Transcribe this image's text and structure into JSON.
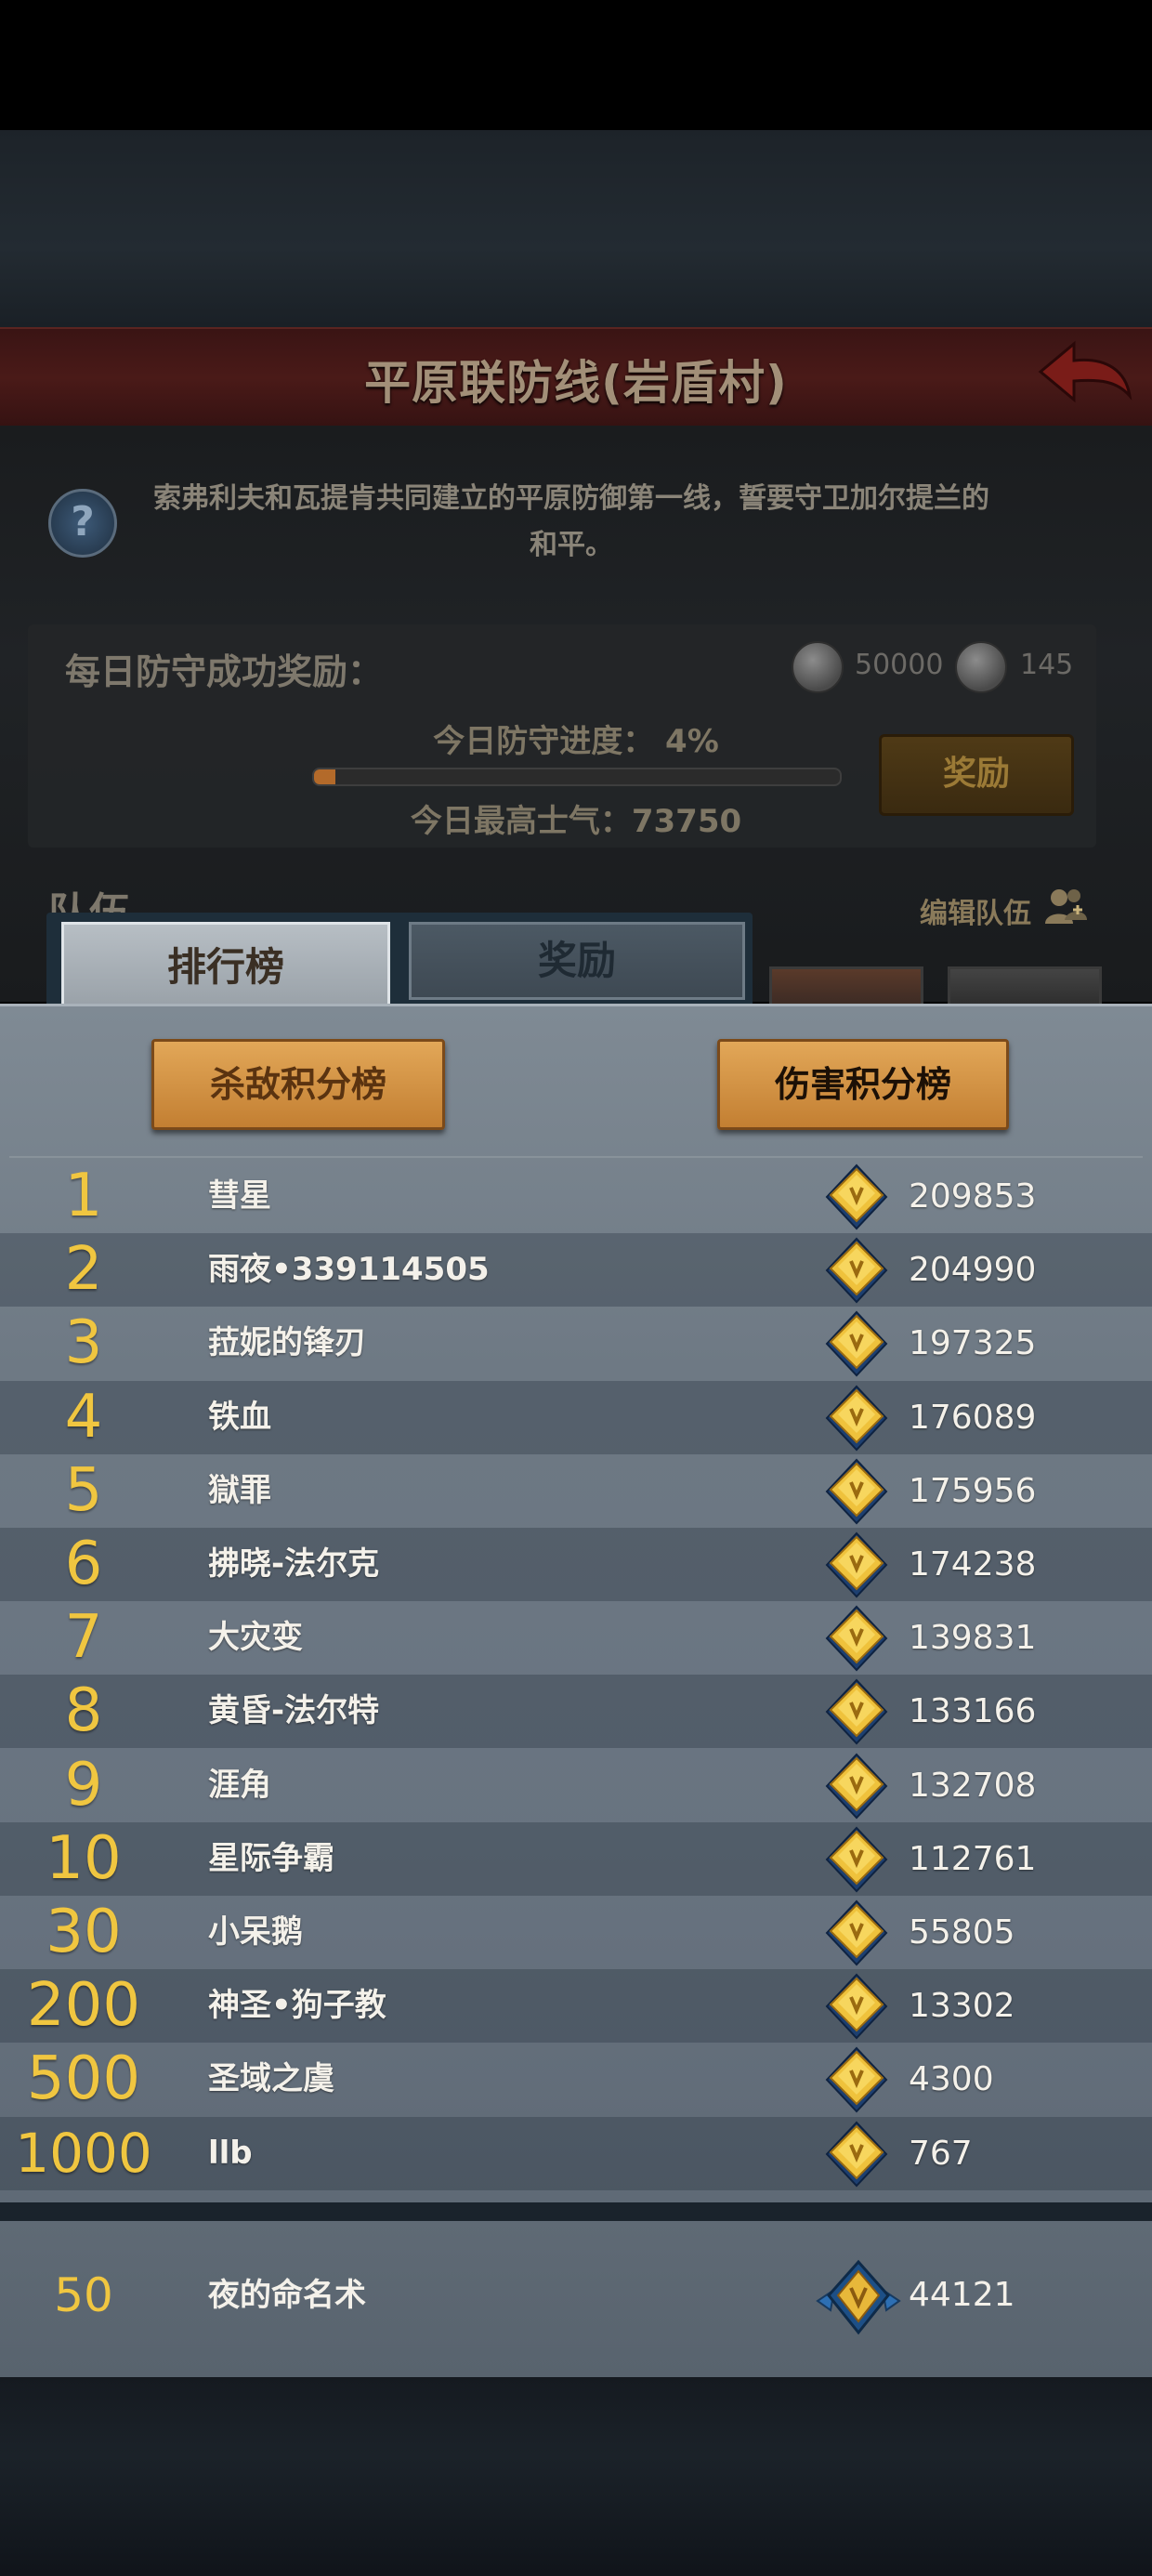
{
  "header": {
    "title": "平原联防线(岩盾村)",
    "back_icon": "back-arrow-icon"
  },
  "info": {
    "description_line1": "索弗利夫和瓦提肯共同建立的平原防御第一线，誓要守卫加尔提兰的",
    "description_line2": "和平。",
    "help_icon": "question-icon"
  },
  "daily": {
    "label": "每日防守成功奖励：",
    "silver_amount": "50000",
    "stone_amount": "145",
    "progress_text": "今日防守进度： 4%",
    "progress_fraction": 0.04,
    "morale_text": "今日最高士气：73750",
    "reward_button": "奖励"
  },
  "team": {
    "label": "队伍",
    "edit_label": "编辑队伍"
  },
  "tabs": [
    {
      "label": "排行榜",
      "active": true
    },
    {
      "label": "奖励",
      "active": false
    }
  ],
  "board": {
    "kill_button": "杀敌积分榜",
    "damage_button": "伤害积分榜",
    "rows": [
      {
        "rank": "1",
        "name": "彗星",
        "score": "209853"
      },
      {
        "rank": "2",
        "name": "雨夜•339114505",
        "score": "204990"
      },
      {
        "rank": "3",
        "name": "菈妮的锋刃",
        "score": "197325"
      },
      {
        "rank": "4",
        "name": "铁血",
        "score": "176089"
      },
      {
        "rank": "5",
        "name": "獄罪",
        "score": "175956"
      },
      {
        "rank": "6",
        "name": "拂晓-法尔克",
        "score": "174238"
      },
      {
        "rank": "7",
        "name": "大灾变",
        "score": "139831"
      },
      {
        "rank": "8",
        "name": "黄昏-法尔特",
        "score": "133166"
      },
      {
        "rank": "9",
        "name": "涯角",
        "score": "132708"
      },
      {
        "rank": "10",
        "name": "星际争霸",
        "score": "112761"
      },
      {
        "rank": "30",
        "name": "小呆鹅",
        "score": "55805"
      },
      {
        "rank": "200",
        "name": "神圣•狗子教",
        "score": "13302"
      },
      {
        "rank": "500",
        "name": "圣域之虞",
        "score": "4300"
      },
      {
        "rank": "1000",
        "name": "llb",
        "score": "767"
      }
    ]
  },
  "me": {
    "rank": "50",
    "name": "夜的命名术",
    "score": "44121"
  },
  "colors": {
    "rank_gold": "#f0c640",
    "button_gold": "#d9974a",
    "title_bar": "#4a1a18"
  }
}
